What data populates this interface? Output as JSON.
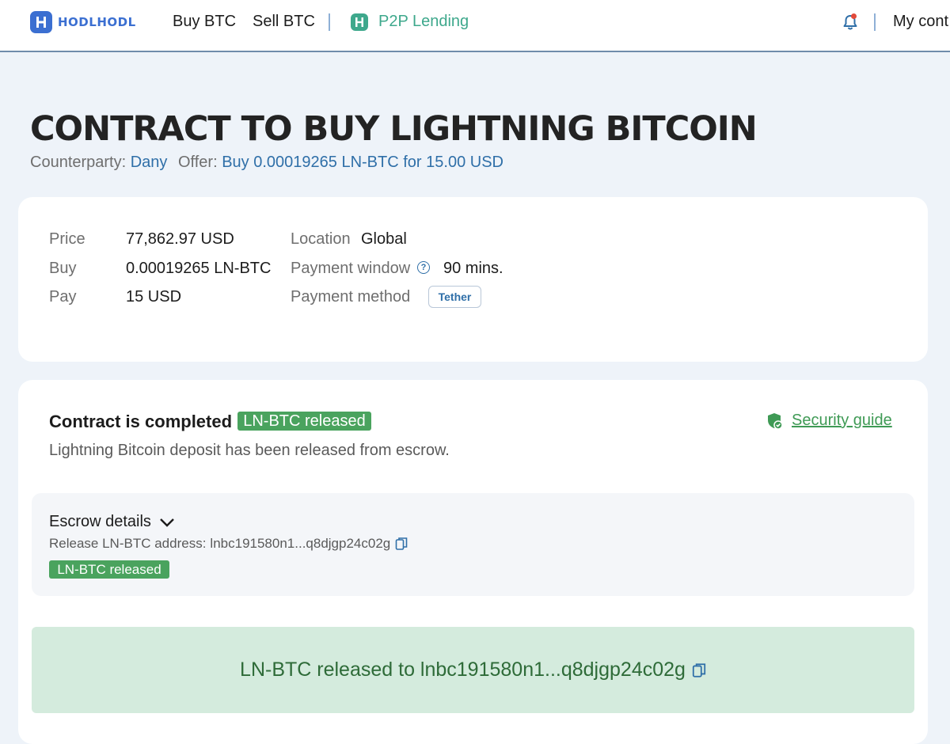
{
  "nav": {
    "logo_text": "HODLHODL",
    "buy_btc": "Buy BTC",
    "sell_btc": "Sell BTC",
    "p2p_lending": "P2P Lending",
    "my_contracts": "My cont"
  },
  "header": {
    "title": "CONTRACT TO BUY LIGHTNING BITCOIN",
    "counterparty_label": "Counterparty:",
    "counterparty_value": "Dany",
    "offer_label": "Offer:",
    "offer_value": "Buy 0.00019265 LN-BTC for 15.00 USD"
  },
  "details": {
    "price_label": "Price",
    "price_value": "77,862.97 USD",
    "buy_label": "Buy",
    "buy_value": "0.00019265 LN-BTC",
    "pay_label": "Pay",
    "pay_value": "15 USD",
    "location_label": "Location",
    "location_value": "Global",
    "payment_window_label": "Payment window",
    "payment_window_value": "90 mins.",
    "payment_method_label": "Payment method",
    "payment_method_value": "Tether"
  },
  "status": {
    "title": "Contract is completed",
    "badge": "LN-BTC released",
    "description": "Lightning Bitcoin deposit has been released from escrow.",
    "security_guide": "Security guide"
  },
  "escrow": {
    "heading": "Escrow details",
    "release_label": "Release LN-BTC address:",
    "release_address": "lnbc191580n1...q8djgp24c02g",
    "badge": "LN-BTC released"
  },
  "banner": {
    "text": "LN-BTC released to lnbc191580n1...q8djgp24c02g"
  },
  "colors": {
    "brand_blue": "#3b6fd1",
    "link_blue": "#2f6fa8",
    "success_green": "#4aa35e",
    "banner_bg": "#d4ebdd"
  }
}
